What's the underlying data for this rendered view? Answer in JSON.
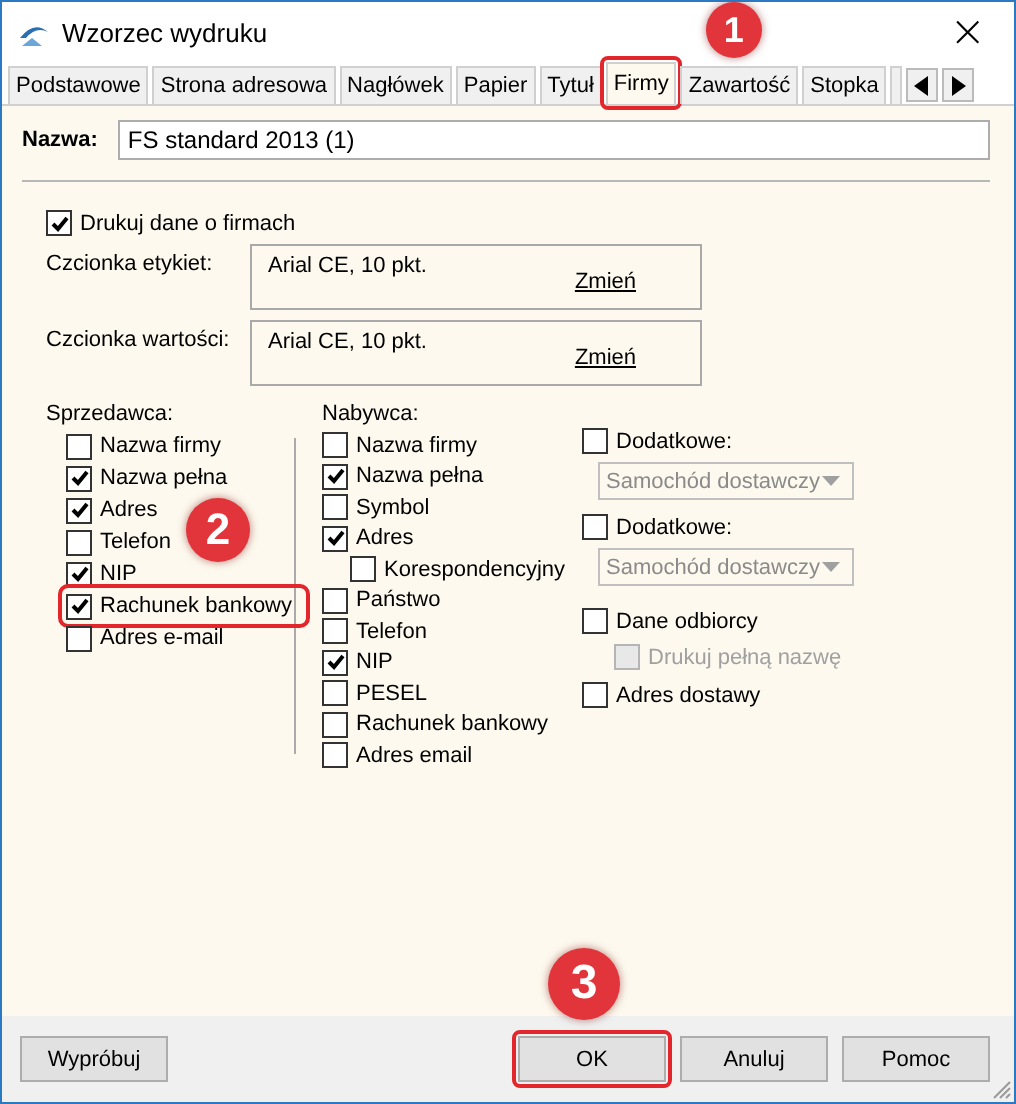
{
  "window": {
    "title": "Wzorzec wydruku",
    "close": "×"
  },
  "tabs": [
    {
      "label": "Podstawowe",
      "selected": false
    },
    {
      "label": "Strona adresowa",
      "selected": false
    },
    {
      "label": "Nagłówek",
      "selected": false
    },
    {
      "label": "Papier",
      "selected": false
    },
    {
      "label": "Tytuł",
      "selected": false
    },
    {
      "label": "Firmy",
      "selected": true,
      "callout": "1"
    },
    {
      "label": "Zawartość",
      "selected": false
    },
    {
      "label": "Stopka",
      "selected": false
    }
  ],
  "name_field": {
    "label": "Nazwa:",
    "value": "FS standard 2013 (1)"
  },
  "print_company_data": {
    "label": "Drukuj dane o firmach",
    "checked": true
  },
  "fonts": [
    {
      "label": "Czcionka etykiet:",
      "value": "Arial CE, 10 pkt.",
      "link": "Zmień"
    },
    {
      "label": "Czcionka wartości:",
      "value": "Arial CE, 10 pkt.",
      "link": "Zmień"
    }
  ],
  "seller": {
    "title": "Sprzedawca:",
    "items": [
      {
        "label": "Nazwa firmy",
        "checked": false
      },
      {
        "label": "Nazwa pełna",
        "checked": true
      },
      {
        "label": "Adres",
        "checked": true
      },
      {
        "label": "Telefon",
        "checked": false
      },
      {
        "label": "NIP",
        "checked": true
      },
      {
        "label": "Rachunek bankowy",
        "checked": true,
        "callout": "2"
      },
      {
        "label": "Adres e-mail",
        "checked": false
      }
    ]
  },
  "buyer": {
    "title": "Nabywca:",
    "items": [
      {
        "label": "Nazwa firmy",
        "checked": false
      },
      {
        "label": "Nazwa pełna",
        "checked": true
      },
      {
        "label": "Symbol",
        "checked": false
      },
      {
        "label": "Adres",
        "checked": true,
        "children": [
          {
            "label": "Korespondencyjny",
            "checked": false
          }
        ]
      },
      {
        "label": "Państwo",
        "checked": false
      },
      {
        "label": "Telefon",
        "checked": false
      },
      {
        "label": "NIP",
        "checked": true
      },
      {
        "label": "PESEL",
        "checked": false
      },
      {
        "label": "Rachunek bankowy",
        "checked": false
      },
      {
        "label": "Adres email",
        "checked": false
      }
    ]
  },
  "extra": [
    {
      "kind": "dropdown",
      "label": "Dodatkowe:",
      "checked": false,
      "select": {
        "value": "Samochód dostawczy",
        "disabled": true
      }
    },
    {
      "kind": "dropdown",
      "label": "Dodatkowe:",
      "checked": false,
      "select": {
        "value": "Samochód dostawczy",
        "disabled": true
      }
    },
    {
      "kind": "checkbox",
      "label": "Dane odbiorcy",
      "checked": false,
      "children": [
        {
          "label": "Drukuj pełną nazwę",
          "checked": false,
          "disabled": true
        }
      ]
    },
    {
      "kind": "checkbox",
      "label": "Adres dostawy",
      "checked": false
    }
  ],
  "buttons": [
    {
      "label": "Wypróbuj",
      "kind": "left"
    },
    {
      "label": "OK",
      "kind": "right",
      "callout": "3"
    },
    {
      "label": "Anuluj",
      "kind": "right"
    },
    {
      "label": "Pomoc",
      "kind": "right"
    }
  ]
}
